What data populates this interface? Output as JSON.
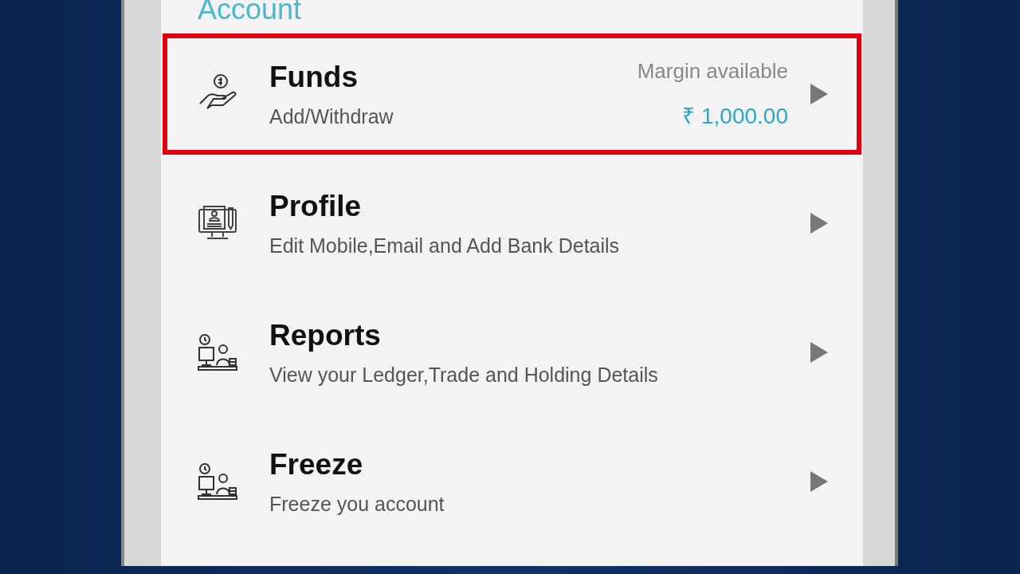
{
  "section_title": "Account",
  "items": [
    {
      "kind": "funds",
      "title": "Funds",
      "subtitle": "Add/Withdraw",
      "highlighted": true,
      "side_label": "Margin available",
      "side_value": "₹ 1,000.00"
    },
    {
      "kind": "profile",
      "title": "Profile",
      "subtitle": "Edit Mobile,Email and Add Bank Details",
      "highlighted": false
    },
    {
      "kind": "reports",
      "title": "Reports",
      "subtitle": "View your Ledger,Trade and Holding Details",
      "highlighted": false
    },
    {
      "kind": "freeze",
      "title": "Freeze",
      "subtitle": "Freeze you account",
      "highlighted": false
    }
  ]
}
